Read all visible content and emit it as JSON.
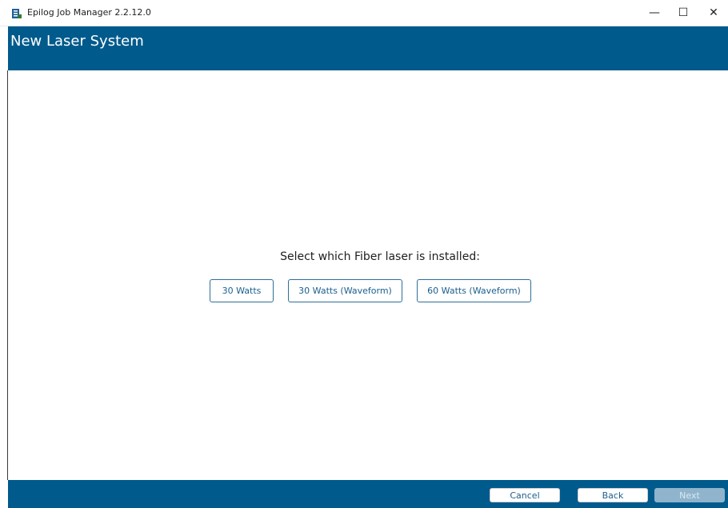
{
  "window": {
    "title": "Epilog Job Manager 2.2.12.0",
    "minimize_glyph": "—",
    "maximize_glyph": "☐",
    "close_glyph": "✕"
  },
  "header": {
    "title": "New Laser System"
  },
  "main": {
    "prompt": "Select which Fiber laser is installed:",
    "options": [
      "30 Watts",
      "30 Watts (Waveform)",
      "60 Watts (Waveform)"
    ]
  },
  "footer": {
    "cancel_label": "Cancel",
    "back_label": "Back",
    "next_label": "Next",
    "next_enabled": false
  },
  "colors": {
    "brand_blue": "#005a8c",
    "button_text": "#1b5f8d",
    "disabled_button": "#8fb4cc"
  },
  "icons": {
    "app": "epilog-app-icon",
    "minimize": "minimize-icon",
    "maximize": "maximize-icon",
    "close": "close-icon"
  }
}
